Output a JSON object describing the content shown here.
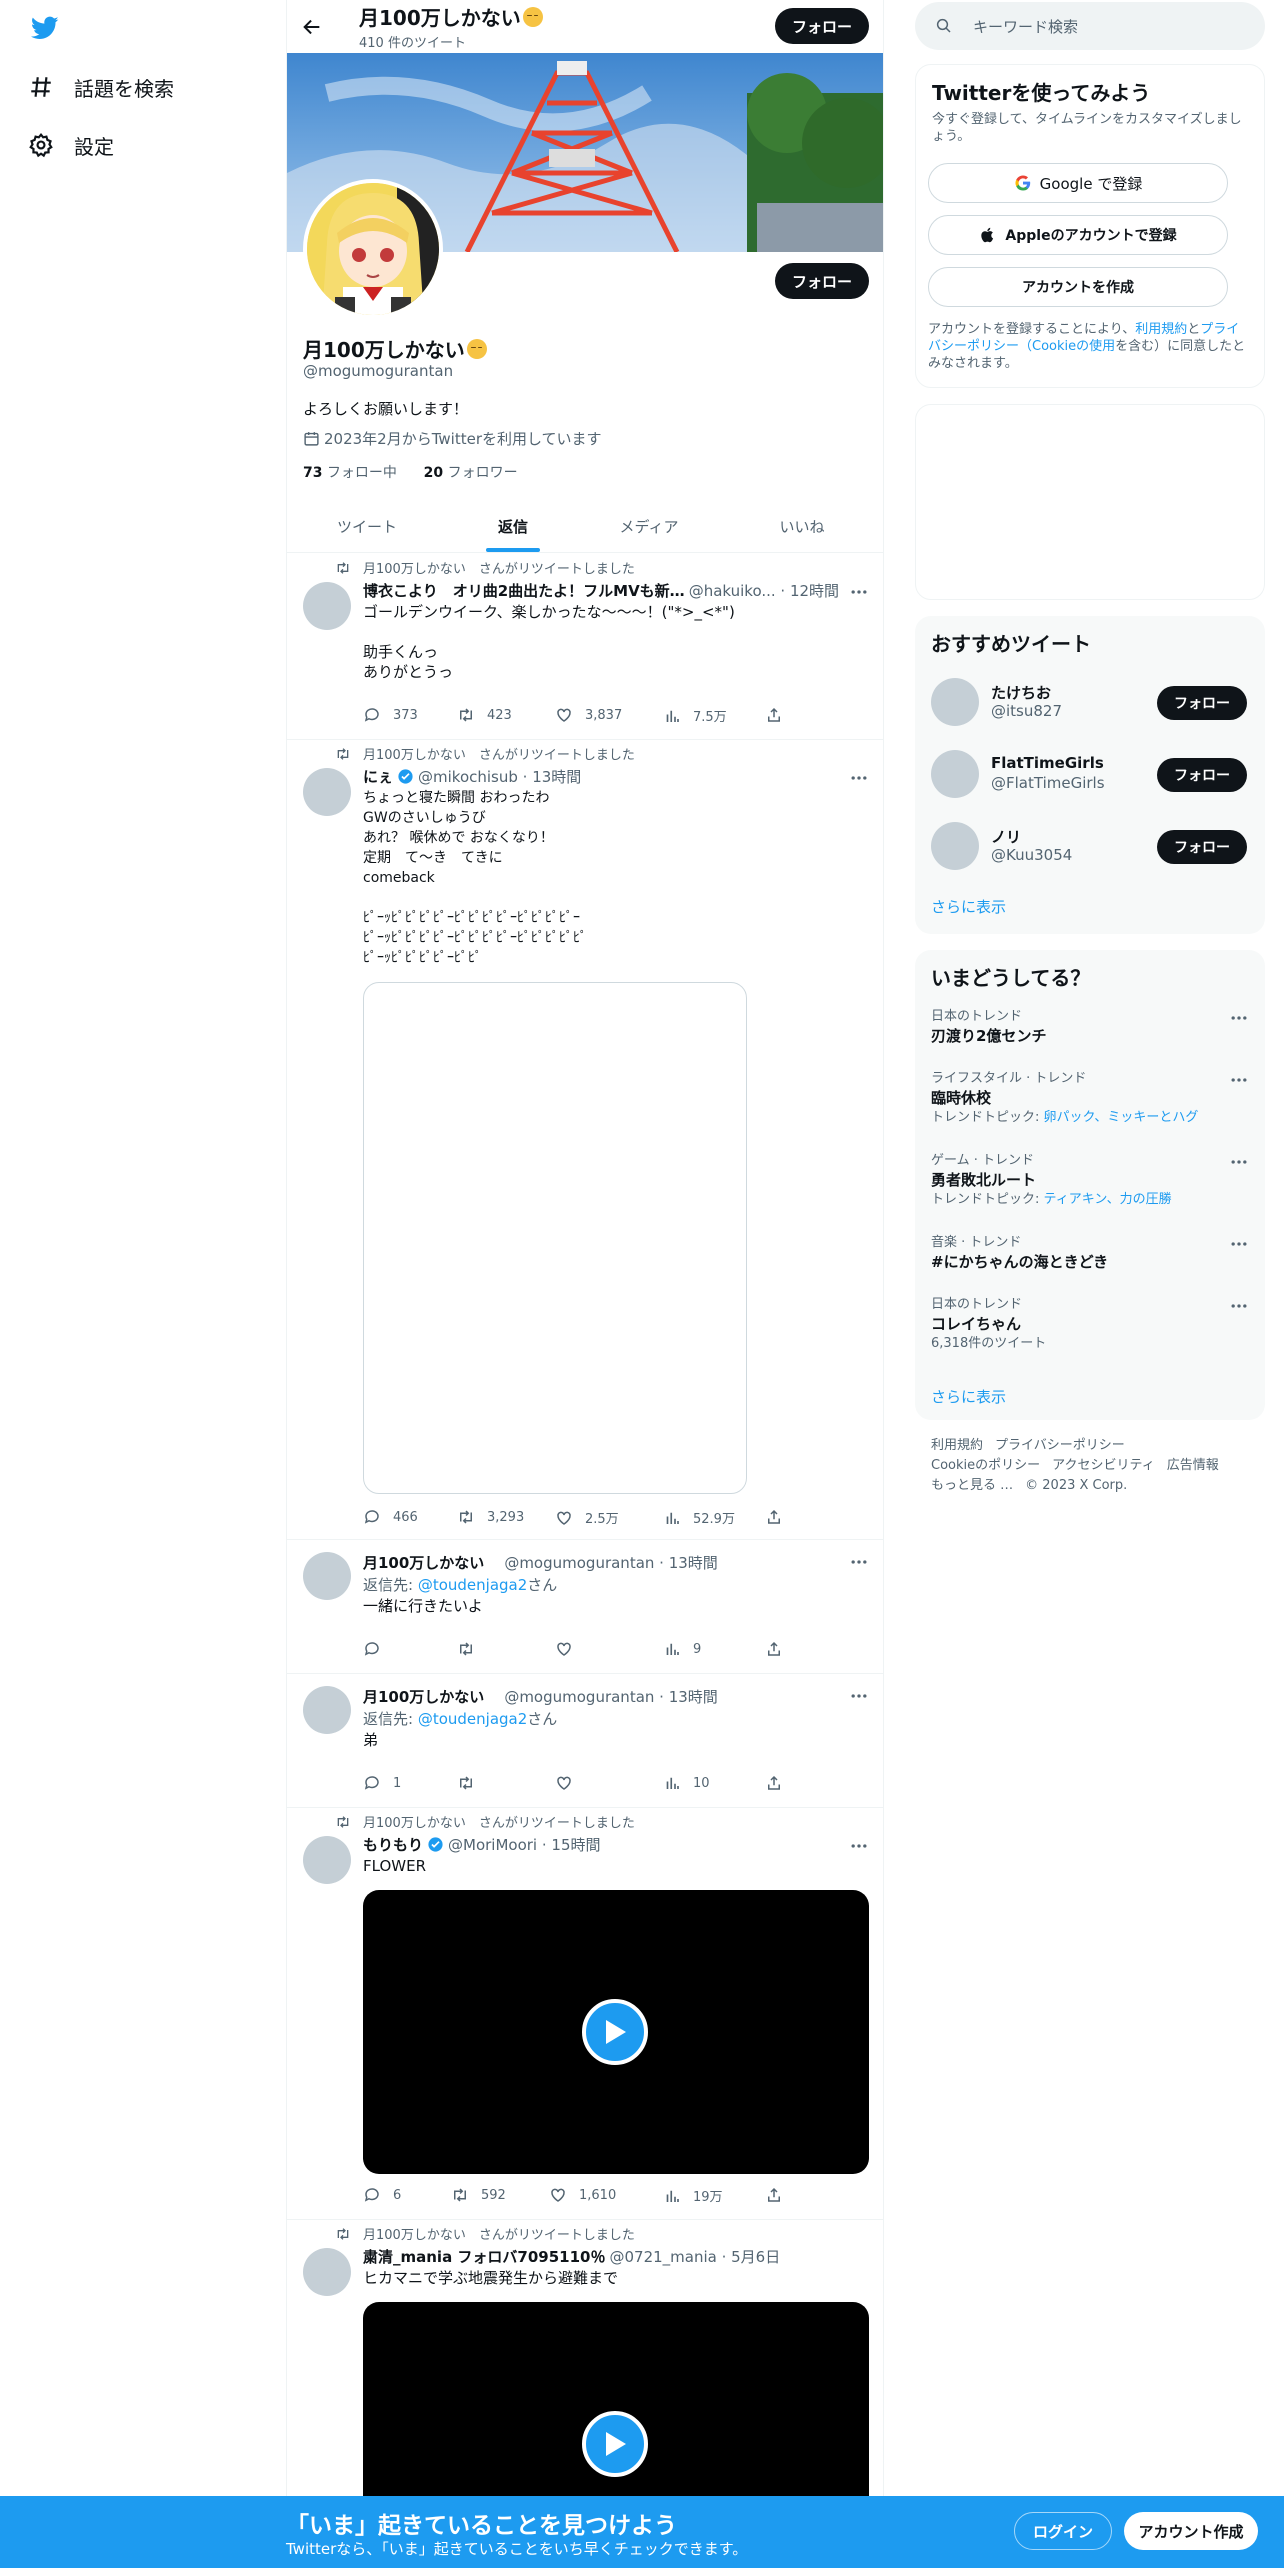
{
  "nav": {
    "explore_label": "話題を検索",
    "settings_label": "設定"
  },
  "header": {
    "title": "月100万しかない",
    "tweet_count": "410 件のツイート",
    "follow_label": "フォロー"
  },
  "profile": {
    "name": "月100万しかない",
    "handle": "@mogumogurantan",
    "bio": "よろしくお願いします！",
    "joined": "2023年2月からTwitterを利用しています",
    "following_count": "73",
    "following_label": "フォロー中",
    "followers_count": "20",
    "followers_label": "フォロワー",
    "follow_label": "フォロー"
  },
  "tabs": [
    {
      "label": "ツイート"
    },
    {
      "label": "返信"
    },
    {
      "label": "メディア"
    },
    {
      "label": "いいね"
    }
  ],
  "tweets": [
    {
      "retweet_note": "月100万しかない　さんがリツイートしました",
      "name": "博衣こより　オリ曲2曲出たよ！フルMVも新…",
      "meta": "@hakuiko... · 12時間",
      "text": "ゴールデンウイーク、楽しかったな〜〜〜！(\"*>_<*\")\n\n助手くんっ\nありがとうっ",
      "replies": "373",
      "retweets": "423",
      "likes": "3,837",
      "views": "7.5万"
    },
    {
      "retweet_note": "月100万しかない　さんがリツイートしました",
      "name": "にぇ",
      "meta": "@mikochisub · 13時間",
      "text": "ちょっと寝た瞬間 おわったわ\nGWのさいしゅうび\nあれ？ 喉休めで おなくなり！\n定期　て～き　てきに\ncomeback\n\nﾋﾟｰｯﾋﾟﾋﾟﾋﾟﾋﾟｰﾋﾟﾋﾟﾋﾟﾋﾟｰﾋﾟﾋﾟﾋﾟﾋﾟｰ\nﾋﾟｰｯﾋﾟﾋﾟﾋﾟﾋﾟｰﾋﾟﾋﾟﾋﾟﾋﾟｰﾋﾟﾋﾟﾋﾟﾋﾟﾋﾟ\nﾋﾟｰｯﾋﾟﾋﾟﾋﾟﾋﾟｰﾋﾟﾋﾟ",
      "replies": "466",
      "retweets": "3,293",
      "likes": "2.5万",
      "views": "52.9万"
    },
    {
      "name": "月100万しかない",
      "meta": "@mogumogurantan · 13時間",
      "reply_prefix": "返信先: ",
      "reply_handle": "@toudenjaga2",
      "reply_suffix": "さん",
      "text": "一緒に行きたいよ",
      "replies": "",
      "retweets": "",
      "likes": "",
      "views": "9"
    },
    {
      "name": "月100万しかない",
      "meta": "@mogumogurantan · 13時間",
      "reply_prefix": "返信先: ",
      "reply_handle": "@toudenjaga2",
      "reply_suffix": "さん",
      "text": "弟",
      "replies": "1",
      "retweets": "",
      "likes": "",
      "views": "10"
    },
    {
      "retweet_note": "月100万しかない　さんがリツイートしました",
      "name": "もりもり",
      "meta": "@MoriMoori · 15時間",
      "text": "FLOWER",
      "replies": "6",
      "retweets": "592",
      "likes": "1,610",
      "views": "19万"
    },
    {
      "retweet_note": "月100万しかない　さんがリツイートしました",
      "name": "粛清_mania フォロバ7095110％",
      "meta": "@0721_mania · 5月6日",
      "text": "ヒカマニで学ぶ地震発生から避難まで"
    }
  ],
  "sidebar": {
    "search_placeholder": "キーワード検索",
    "signup": {
      "title": "Twitterを使ってみよう",
      "subtitle": "今すぐ登録して、タイムラインをカスタマイズしましょう。",
      "google_label": "Google で登録",
      "apple_label": "Appleのアカウントで登録",
      "create_label": "アカウントを作成",
      "legal_prefix": "アカウントを登録することにより、",
      "legal_terms": "利用規約",
      "legal_and": "と",
      "legal_privacy": "プライバシーポリシー（Cookieの使用",
      "legal_suffix": "を含む）に同意したとみなされます。"
    },
    "who_to_follow": {
      "title": "おすすめツイート",
      "users": [
        {
          "name": "たけちお",
          "handle": "@itsu827"
        },
        {
          "name": "FlatTimeGirls",
          "handle": "@FlatTimeGirls"
        },
        {
          "name": "ノリ",
          "handle": "@Kuu3054"
        }
      ],
      "follow_label": "フォロー",
      "show_more": "さらに表示"
    },
    "trends": {
      "title": "いまどうしてる？",
      "items": [
        {
          "category": "日本のトレンド",
          "name": "刃渡り2億センチ",
          "sub_prefix": "",
          "sub_link": ""
        },
        {
          "category": "ライフスタイル · トレンド",
          "name": "臨時休校",
          "sub_prefix": "トレンドトピック: ",
          "sub_link": "卵パック、ミッキーとハグ"
        },
        {
          "category": "ゲーム · トレンド",
          "name": "勇者敗北ルート",
          "sub_prefix": "トレンドトピック: ",
          "sub_link": "ティアキン、力の圧勝"
        },
        {
          "category": "音楽 · トレンド",
          "name": "#にかちゃんの海ときどき",
          "sub_prefix": "",
          "sub_link": ""
        },
        {
          "category": "日本のトレンド",
          "name": "コレイちゃん",
          "sub_prefix": "6,318件のツイート",
          "sub_link": ""
        }
      ],
      "show_more": "さらに表示"
    },
    "footer": {
      "links": [
        "利用規約",
        "プライバシーポリシー",
        "Cookieのポリシー",
        "アクセシビリティ",
        "広告情報",
        "もっと見る …",
        "© 2023 X Corp."
      ]
    }
  },
  "bottom_bar": {
    "title": "「いま」起きていることを見つけよう",
    "subtitle": "Twitterなら、「いま」起きていることをいち早くチェックできます。",
    "login_label": "ログイン",
    "signup_label": "アカウント作成"
  },
  "colors": {
    "accent": "#1d9bf0",
    "text": "#0f1419",
    "secondary": "#536471",
    "border": "#eff3f4"
  }
}
